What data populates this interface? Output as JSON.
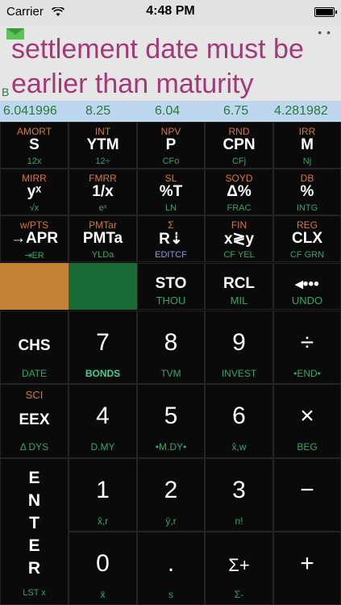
{
  "status_bar": {
    "carrier": "Carrier",
    "time": "4:48 PM"
  },
  "display": {
    "message": "settlement date must be earlier than maturity",
    "mode": "B",
    "stack": [
      "6.041996",
      "8.25",
      "6.04",
      "6.75",
      "4.281982"
    ]
  },
  "keys": [
    {
      "top": "AMORT",
      "main": "S",
      "bottom": "12x"
    },
    {
      "top": "INT",
      "main": "YTM",
      "bottom": "12÷"
    },
    {
      "top": "NPV",
      "main": "P",
      "bottom": "CFo"
    },
    {
      "top": "RND",
      "main": "CPN",
      "bottom": "CFj"
    },
    {
      "top": "IRR",
      "main": "M",
      "bottom": "Nj"
    },
    {
      "top": "MIRR",
      "main": "yˣ",
      "bottom": "√x"
    },
    {
      "top": "FMRR",
      "main": "1/x",
      "bottom": "eˣ"
    },
    {
      "top": "SL",
      "main": "%T",
      "bottom": "LN"
    },
    {
      "top": "SOYD",
      "main": "Δ%",
      "bottom": "FRAC"
    },
    {
      "top": "DB",
      "main": "%",
      "bottom": "INTG"
    },
    {
      "top": "w/PTS",
      "main": "→APR",
      "bottom": "⇥ER"
    },
    {
      "top": "PMTar",
      "main": "PMTa",
      "bottom": "YLDa"
    },
    {
      "top": "Σ",
      "main": "R⇣",
      "bottom": "EDITCF"
    },
    {
      "top": "FIN",
      "main": "x≷y",
      "bottom": "CF YEL"
    },
    {
      "top": "REG",
      "main": "CLX",
      "bottom": "CF GRN"
    },
    {
      "top": "",
      "main": "",
      "bottom": ""
    },
    {
      "top": "",
      "main": "",
      "bottom": ""
    },
    {
      "top": "",
      "main": "STO",
      "bottom": "THOU"
    },
    {
      "top": "",
      "main": "RCL",
      "bottom": "MIL"
    },
    {
      "top": "",
      "main": "◂•••",
      "bottom": "UNDO"
    },
    {
      "top": "",
      "main": "CHS",
      "bottom": "DATE"
    },
    {
      "top": "",
      "main": "7",
      "bottom": "BONDS"
    },
    {
      "top": "",
      "main": "8",
      "bottom": "TVM"
    },
    {
      "top": "",
      "main": "9",
      "bottom": "INVEST"
    },
    {
      "top": "",
      "main": "÷",
      "bottom": "•END•"
    },
    {
      "top": "SCI",
      "main": "EEX",
      "bottom": "Δ DYS"
    },
    {
      "top": "",
      "main": "4",
      "bottom": "D.MY"
    },
    {
      "top": "",
      "main": "5",
      "bottom": "•M.DY•"
    },
    {
      "top": "",
      "main": "6",
      "bottom": "x̂,w"
    },
    {
      "top": "",
      "main": "×",
      "bottom": "BEG"
    },
    {
      "top": "",
      "main": "1",
      "bottom": "x̂,r"
    },
    {
      "top": "",
      "main": "2",
      "bottom": "ŷ,r"
    },
    {
      "top": "",
      "main": "3",
      "bottom": "n!"
    },
    {
      "top": "",
      "main": "−",
      "bottom": ""
    },
    {
      "top": "",
      "main": "0",
      "bottom": "x̄"
    },
    {
      "top": "",
      "main": ".",
      "bottom": "s"
    },
    {
      "top": "",
      "main": "Σ+",
      "bottom": "Σ-"
    },
    {
      "top": "",
      "main": "+",
      "bottom": ""
    }
  ],
  "enter_key": {
    "label": "ENTER",
    "letters": [
      "E",
      "N",
      "T",
      "E",
      "R"
    ],
    "bottom": "LST x"
  }
}
